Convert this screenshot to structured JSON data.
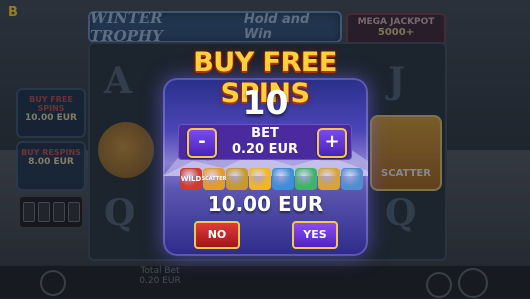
{
  "game": {
    "logo": "B",
    "title_main": "WINTER TROPHY",
    "title_sub": "Hold and Win",
    "mega_label": "MEGA JACKPOT",
    "mega_value": "5000+",
    "side_buy_free": "BUY FREE SPINS",
    "side_buy_free_price": "10.00 EUR",
    "side_buy_respins": "BUY RESPINS",
    "side_buy_respins_price": "8.00 EUR",
    "reel_symbols": [
      "A",
      "J",
      "Q",
      "Q"
    ],
    "scatter_label": "SCATTER",
    "total_bet_label": "Total Bet",
    "total_bet_value": "0.20 EUR"
  },
  "modal": {
    "title": "BUY FREE SPINS",
    "spins": "10",
    "bet_label": "BET",
    "bet_value": "0.20 EUR",
    "minus_label": "-",
    "plus_label": "+",
    "price": "10.00 EUR",
    "no_label": "NO",
    "yes_label": "YES",
    "symbols": [
      {
        "name": "wild-symbol-icon",
        "text": "WILD",
        "color": "#d23b2c"
      },
      {
        "name": "scatter-symbol-icon",
        "text": "SCATTER",
        "color": "#e79a25"
      },
      {
        "name": "trophy-symbol-icon",
        "text": "",
        "color": "#c79a2a"
      },
      {
        "name": "gold-coin-icon",
        "text": "",
        "color": "#f0b724"
      },
      {
        "name": "globe-symbol-icon",
        "text": "",
        "color": "#3c8fd8"
      },
      {
        "name": "green-globe-icon",
        "text": "",
        "color": "#3fb36a"
      },
      {
        "name": "medal-symbol-icon",
        "text": "",
        "color": "#d7a43b"
      },
      {
        "name": "skier-symbol-icon",
        "text": "",
        "color": "#4f8fd0"
      }
    ]
  }
}
